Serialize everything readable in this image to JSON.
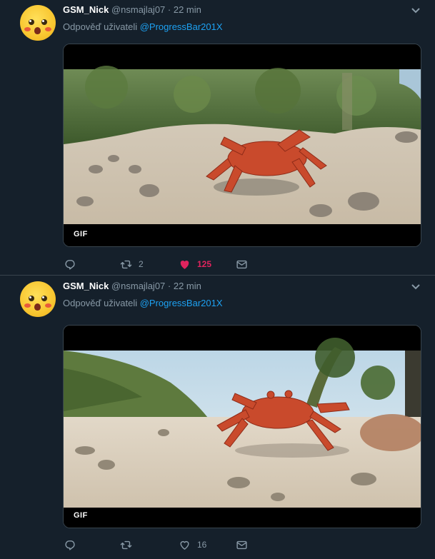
{
  "tweets": [
    {
      "display_name": "GSM_Nick",
      "handle": "@nsmajlaj07",
      "separator": " · ",
      "time": "22 min",
      "reply_prefix": "Odpověď uživateli ",
      "reply_to": "@ProgressBar201X",
      "media_badge": "GIF",
      "reply_count": "",
      "retweet_count": "2",
      "like_count": "125",
      "liked": true
    },
    {
      "display_name": "GSM_Nick",
      "handle": "@nsmajlaj07",
      "separator": " · ",
      "time": "22 min",
      "reply_prefix": "Odpověď uživateli ",
      "reply_to": "@ProgressBar201X",
      "media_badge": "GIF",
      "reply_count": "",
      "retweet_count": "",
      "like_count": "16",
      "liked": false
    }
  ],
  "colors": {
    "background": "#15202b",
    "muted": "#8899a6",
    "link": "#1da1f2",
    "like_active": "#e0245e"
  }
}
